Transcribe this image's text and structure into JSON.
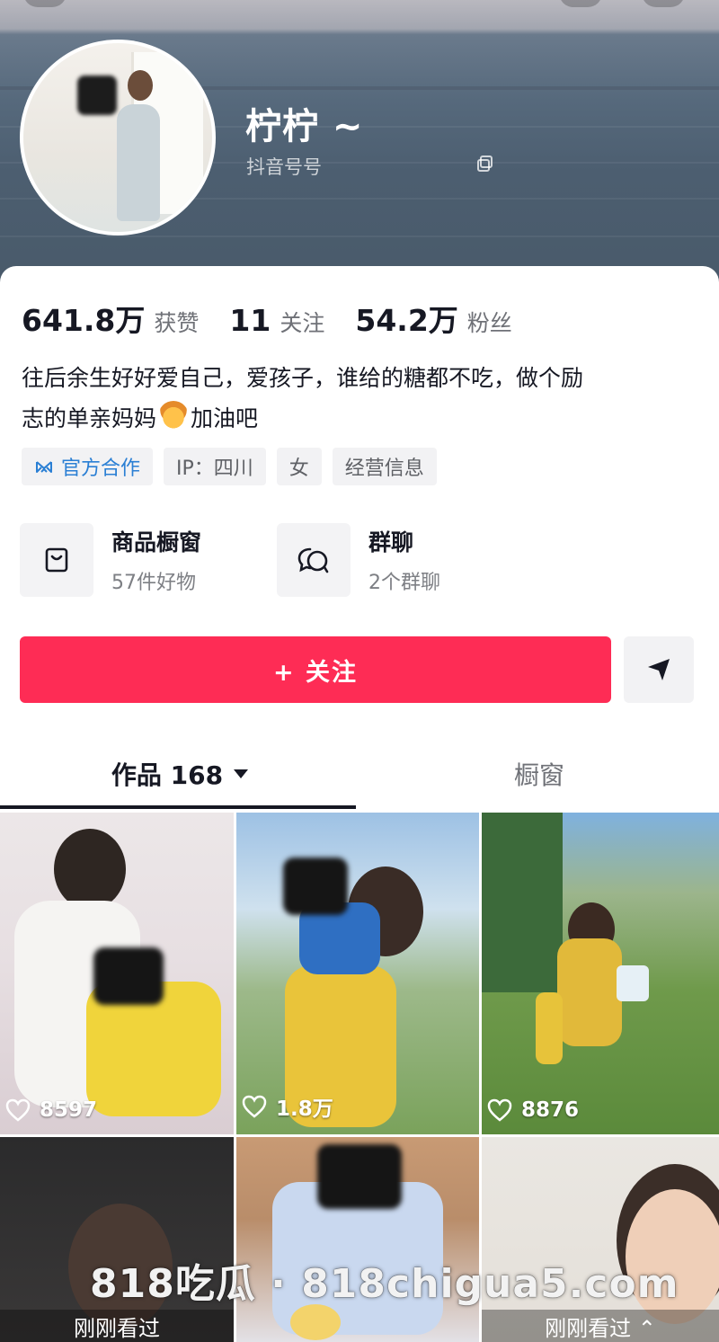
{
  "profile": {
    "username": "柠柠 ~",
    "douyin_id_label": "抖音号号"
  },
  "stats": [
    {
      "value": "641.8万",
      "label": "获赞"
    },
    {
      "value": "11",
      "label": "关注"
    },
    {
      "value": "54.2万",
      "label": "粉丝"
    }
  ],
  "bio": {
    "line1": "往后余生好好爱自己，爱孩子，谁给的糖都不吃，做个励",
    "line2_before": "志的单亲妈妈",
    "line2_after": "加油吧",
    "emoji": "woman-emoji"
  },
  "tags": [
    {
      "label": "官方合作",
      "icon": "official-cooperation-icon"
    },
    {
      "label": "IP：四川"
    },
    {
      "label": "女"
    },
    {
      "label": "经营信息"
    }
  ],
  "shortcuts": [
    {
      "title": "商品橱窗",
      "subtitle": "57件好物",
      "icon": "shopping-bag-icon"
    },
    {
      "title": "群聊",
      "subtitle": "2个群聊",
      "icon": "group-chat-icon"
    }
  ],
  "actions": {
    "follow_label": "+ 关注",
    "share_icon": "send-arrow-icon"
  },
  "tabs": {
    "works_label": "作品 168",
    "window_label": "橱窗"
  },
  "videos": [
    {
      "likes": "8597"
    },
    {
      "likes": "1.8万"
    },
    {
      "likes": "8876"
    },
    {
      "overlay": "刚刚看过"
    },
    {},
    {
      "overlay": "刚刚看过 ⌃"
    }
  ],
  "watermark": "818吃瓜 · 818chigua5.com",
  "colors": {
    "accent": "#fe2c55",
    "official_blue": "#2a7fd4"
  }
}
